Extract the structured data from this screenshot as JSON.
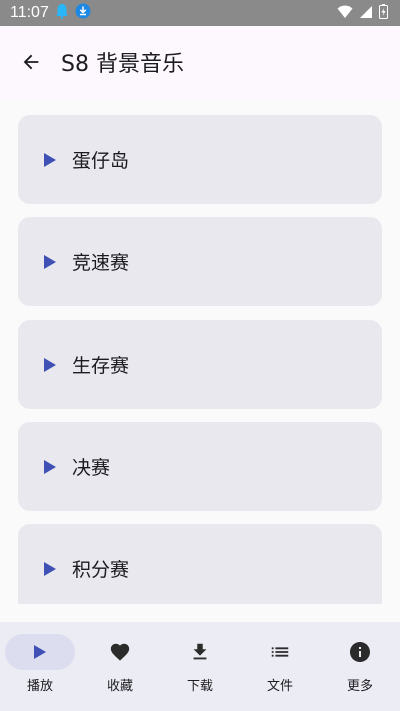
{
  "status_bar": {
    "time": "11:07",
    "icons": [
      "notification-bell-icon",
      "download-notification-icon",
      "wifi-icon",
      "signal-icon",
      "battery-charging-icon"
    ]
  },
  "app_bar": {
    "title": "S8 背景音乐",
    "back_icon": "arrow-back-icon"
  },
  "tracks": [
    {
      "label": "蛋仔岛"
    },
    {
      "label": "竞速赛"
    },
    {
      "label": "生存赛"
    },
    {
      "label": "决赛"
    },
    {
      "label": "积分赛"
    }
  ],
  "bottom_nav": {
    "selected": "播放",
    "items": [
      {
        "label": "播放",
        "icon": "play-icon"
      },
      {
        "label": "收藏",
        "icon": "heart-icon"
      },
      {
        "label": "下载",
        "icon": "download-icon"
      },
      {
        "label": "文件",
        "icon": "list-icon"
      },
      {
        "label": "更多",
        "icon": "info-icon"
      }
    ]
  },
  "colors": {
    "accent": "#3f51b5",
    "card": "#e8e8ee",
    "app_bar": "#fdf7fe",
    "nav_bar": "#ececf4",
    "nav_indicator": "#dcdef0"
  }
}
